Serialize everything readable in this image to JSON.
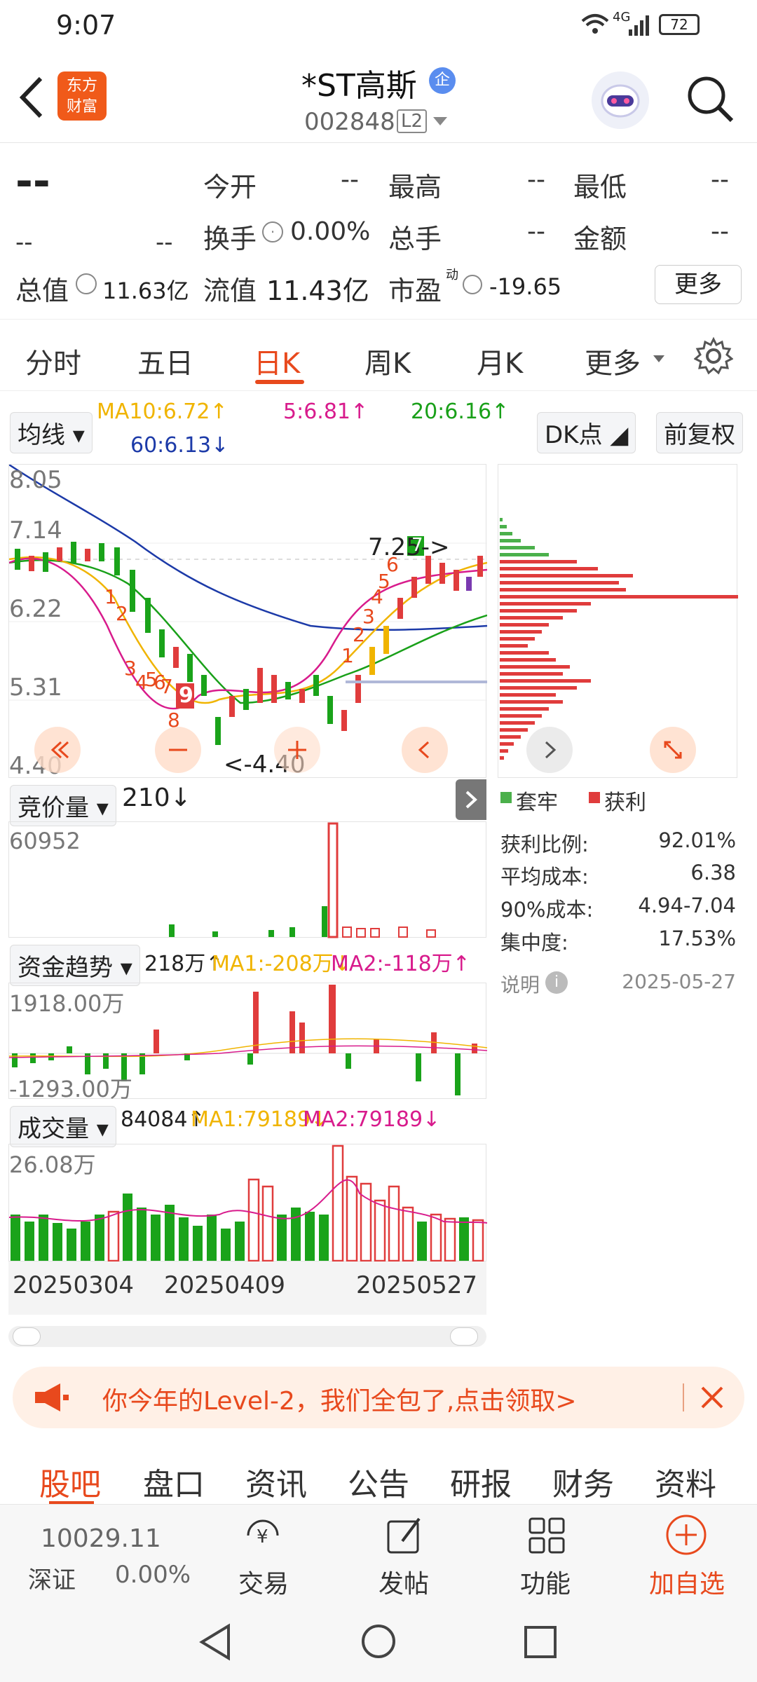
{
  "status": {
    "time": "9:07",
    "network": "4G",
    "battery": "72"
  },
  "header": {
    "back_icon": "chevron-left",
    "logo_line1": "东方",
    "logo_line2": "财富",
    "title": "*ST高斯",
    "badge": "企",
    "code": "002848",
    "level": "L2"
  },
  "quote": {
    "price": "--",
    "change": "--",
    "change_pct": "--",
    "row1": [
      {
        "label": "今开",
        "value": "--"
      },
      {
        "label": "最高",
        "value": "--"
      },
      {
        "label": "最低",
        "value": "--"
      }
    ],
    "row2": [
      {
        "label": "换手",
        "value": "0.00%"
      },
      {
        "label": "总手",
        "value": "--"
      },
      {
        "label": "金额",
        "value": "--"
      }
    ],
    "row3": [
      {
        "label": "总值",
        "value": "11.63亿"
      },
      {
        "label": "流值",
        "value": "11.43亿"
      },
      {
        "label": "市盈",
        "sup": "动",
        "value": "-19.65"
      }
    ],
    "more": "更多"
  },
  "tabs": [
    "分时",
    "五日",
    "日K",
    "周K",
    "月K",
    "更多"
  ],
  "chart": {
    "ma_select": "均线",
    "ma10": "MA10:6.72↑",
    "ma5": "5:6.81↑",
    "ma20": "20:6.16↑",
    "ma60": "60:6.13↓",
    "dk_btn": "DK点",
    "fq_btn": "前复权",
    "ylabels": [
      "8.05",
      "7.14",
      "6.22",
      "5.31",
      "4.40"
    ],
    "high_mark": "7.25->",
    "low_mark": "<-4.40",
    "markers": [
      "1",
      "2",
      "3",
      "4",
      "5",
      "6",
      "7",
      "8",
      "9",
      "1",
      "2",
      "3",
      "4",
      "5",
      "6",
      "7"
    ],
    "bid_select": "竞价量",
    "bid_val": "210↓",
    "bid_max": "60952",
    "fund_select": "资金趋势",
    "fund_val": "218万↑",
    "fund_ma1": "MA1:-208万↓",
    "fund_ma2": "MA2:-118万↑",
    "fund_max": "1918.00万",
    "fund_min": "-1293.00万",
    "vol_select": "成交量",
    "vol_val": "84084↑",
    "vol_ma1": "MA1:79189↓",
    "vol_ma2": "MA2:79189↓",
    "vol_max": "26.08万",
    "dates": [
      "20250304",
      "20250409",
      "20250527"
    ]
  },
  "chips": {
    "legend_trapped": "套牢",
    "legend_profit": "获利",
    "rows": [
      {
        "label": "获利比例:",
        "value": "92.01%"
      },
      {
        "label": "平均成本:",
        "value": "6.38"
      },
      {
        "label": "90%成本:",
        "value": "4.94-7.04"
      },
      {
        "label": "集中度:",
        "value": "17.53%"
      }
    ],
    "note": "说明",
    "date": "2025-05-27"
  },
  "banner": {
    "text": "你今年的Level-2，我们全包了,点击领取>"
  },
  "bottom_tabs": [
    "股吧",
    "盘口",
    "资讯",
    "公告",
    "研报",
    "财务",
    "资料"
  ],
  "toolbar": {
    "index_val": "10029.11",
    "index_name": "深证",
    "index_pct": "0.00%",
    "trade": "交易",
    "post": "发帖",
    "func": "功能",
    "add": "加自选"
  },
  "colors": {
    "accent": "#e8491d",
    "red": "#e03c3c",
    "green": "#1aa31a",
    "ma10": "#f0b400",
    "ma5": "#d81b8c",
    "ma20": "#19a019",
    "ma60": "#1c3aa8"
  }
}
